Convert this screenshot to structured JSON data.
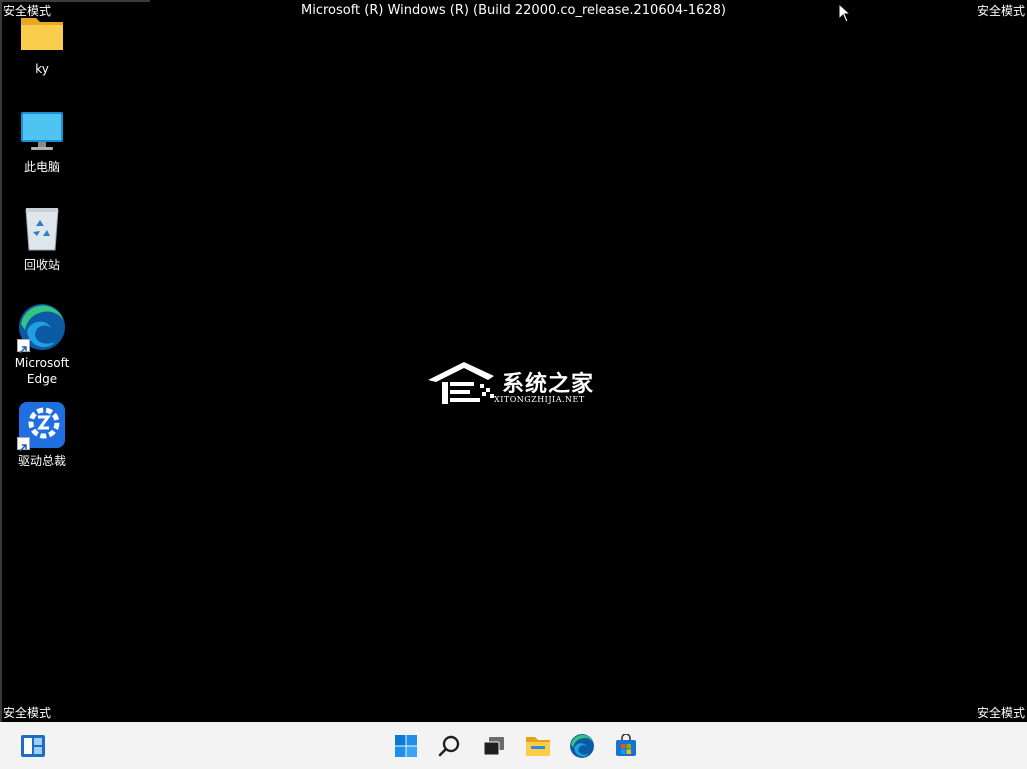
{
  "safe_mode": {
    "top_left": "安全模式",
    "top_right": "安全模式",
    "bottom_left": "安全模式",
    "bottom_right": "安全模式"
  },
  "build_title": "Microsoft (R) Windows (R) (Build 22000.co_release.210604-1628)",
  "desktop_icons": [
    {
      "label": "ky",
      "icon": "folder-icon"
    },
    {
      "label": "此电脑",
      "icon": "monitor-icon"
    },
    {
      "label": "回收站",
      "icon": "recycle-bin-icon"
    },
    {
      "label_line1": "Microsoft",
      "label_line2": "Edge",
      "icon": "edge-icon"
    },
    {
      "label": "驱动总裁",
      "icon": "driver-tool-icon"
    }
  ],
  "watermark": {
    "cn": "系统之家",
    "en": "XITONGZHIJIA.NET"
  },
  "taskbar": {
    "items": [
      "widgets-icon",
      "start-icon",
      "search-icon",
      "task-view-icon",
      "file-explorer-icon",
      "edge-icon",
      "store-icon"
    ]
  },
  "colors": {
    "desktop_bg": "#000000",
    "taskbar_bg": "#f3f3f3",
    "accent_blue": "#0078d4"
  }
}
